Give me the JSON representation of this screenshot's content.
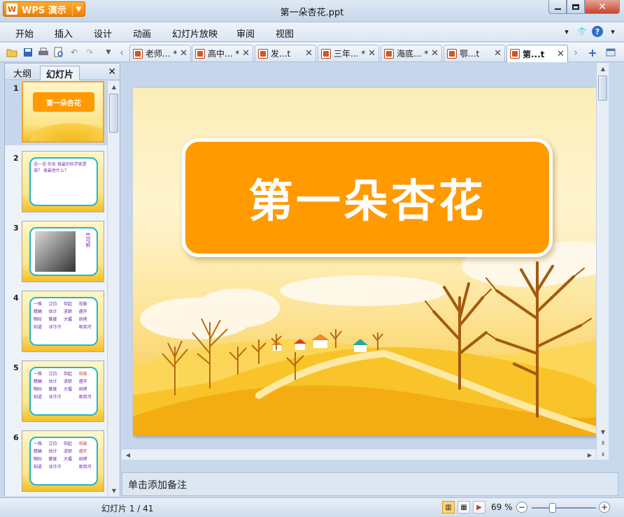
{
  "app": {
    "name": "WPS 演示",
    "doc_title": "第一朵杏花.ppt"
  },
  "menu": [
    "开始",
    "插入",
    "设计",
    "动画",
    "幻灯片放映",
    "审阅",
    "视图"
  ],
  "tabs": [
    {
      "label": "老师... *"
    },
    {
      "label": "高中... *"
    },
    {
      "label": "发...t"
    },
    {
      "label": "三年... *"
    },
    {
      "label": "海底... *"
    },
    {
      "label": "鄂...t"
    },
    {
      "label": "第...t"
    }
  ],
  "left_pane": {
    "tab_outline": "大纲",
    "tab_slides": "幻灯片"
  },
  "thumbs": {
    "n1": "1",
    "n2": "2",
    "n3": "3",
    "n4": "4",
    "n5": "5",
    "n6": "6",
    "t1_title": "第一朵杏花",
    "t2_text": "说一说 你去 很最的科学家是谁？ 很最他什么？",
    "t3_caption": "竺可桢",
    "grid4": [
      "一株",
      "泛白",
      "仰起",
      "攻破",
      "精确",
      "估计",
      "求职",
      "遵开",
      "物际",
      "颤度",
      "大擂",
      "烘烤",
      "知道",
      "冰冷冷",
      "",
      "吸到河"
    ],
    "grid5": [
      "一株",
      "泛白",
      "仰起",
      "攻破",
      "精确",
      "估计",
      "求职",
      "遵开",
      "物际",
      "颤度",
      "大擂",
      "烘烤",
      "知道",
      "冰冷冷",
      "",
      "吸到河"
    ],
    "grid6": [
      "一株",
      "泛白",
      "仰起",
      "攻破",
      "精确",
      "估计",
      "求职",
      "遵开",
      "物际",
      "颤度",
      "大擂",
      "烘烤",
      "知道",
      "冰冷冷",
      "",
      "吸到河"
    ]
  },
  "slide": {
    "title": "第一朵杏花"
  },
  "notes_placeholder": "单击添加备注",
  "status": {
    "slide_info": "幻灯片 1 / 41",
    "zoom": "69 %",
    "zoom_level_percent": 69
  },
  "colors": {
    "accent_orange": "#ff9a00",
    "title_text": "#ffffff"
  }
}
